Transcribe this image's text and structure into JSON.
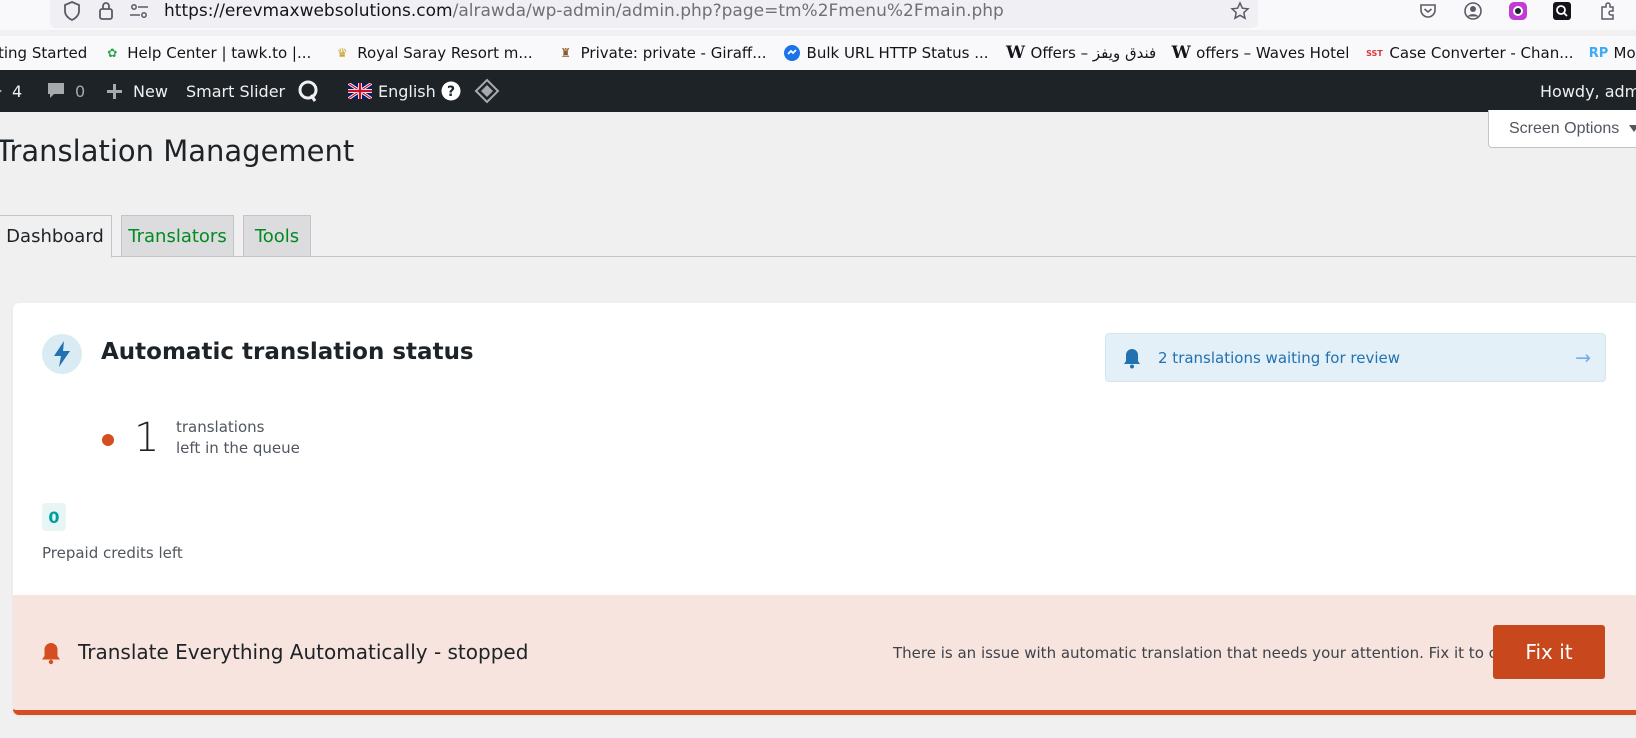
{
  "browser": {
    "url_host": "https://erevmaxwebsolutions.com",
    "url_path": "/alrawda/wp-admin/admin.php?page=tm%2Fmenu%2Fmain.php"
  },
  "bookmarks": [
    {
      "label": "ting Started",
      "icon": "firefox-icon"
    },
    {
      "label": "Help Center | tawk.to |...",
      "icon": "tawk-icon"
    },
    {
      "label": "Royal Saray Resort m...",
      "icon": "resort-icon"
    },
    {
      "label": "Private: private - Giraff...",
      "icon": "giraffe-icon"
    },
    {
      "label": "Bulk URL HTTP Status ...",
      "icon": "status-icon"
    },
    {
      "label": "Offers – فندق ويفز",
      "icon": "waves-icon"
    },
    {
      "label": "offers – Waves Hotel",
      "icon": "waves-icon"
    },
    {
      "label": "Case Converter - Chan...",
      "icon": "sst-icon"
    },
    {
      "label": "Modify image | Resize...",
      "icon": "rp-icon"
    }
  ],
  "adminbar": {
    "updates_count": "4",
    "comments_count": "0",
    "new_label": "New",
    "smart_slider_label": "Smart Slider",
    "language_label": "English",
    "howdy": "Howdy, admi"
  },
  "page": {
    "title": "Translation Management",
    "screen_options": "Screen Options"
  },
  "tabs": [
    {
      "label": "Dashboard",
      "active": true
    },
    {
      "label": "Translators",
      "active": false
    },
    {
      "label": "Tools",
      "active": false
    }
  ],
  "status": {
    "title": "Automatic translation status",
    "review_notice": "2 translations waiting for review",
    "queue_count": "1",
    "queue_label_1": "translations",
    "queue_label_2": "left in the queue",
    "credits_value": "0",
    "credits_label": "Prepaid credits left"
  },
  "alert": {
    "title": "Translate Everything Automatically - stopped",
    "message": "There is an issue with automatic translation that needs your attention. Fix it to continue.",
    "button": "Fix it"
  },
  "colors": {
    "admin_bar": "#1d2327",
    "link_green": "#008a20",
    "accent_orange": "#d54e21",
    "button_orange": "#c8471c",
    "review_blue": "#2271b1"
  }
}
